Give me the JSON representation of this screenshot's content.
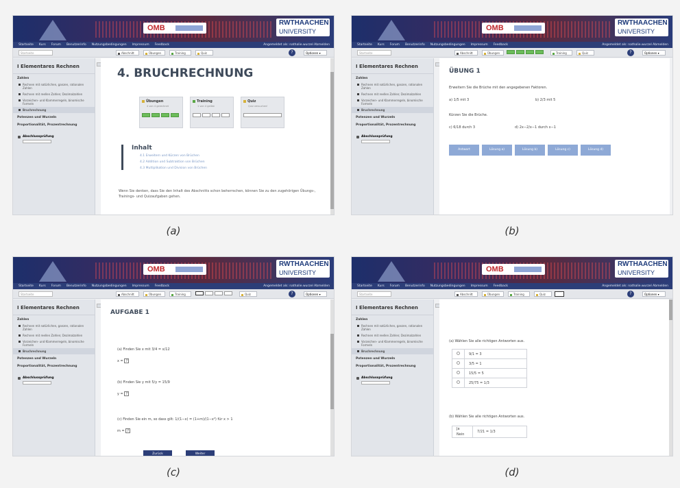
{
  "panels": [
    {
      "caption": "(a)",
      "toolbar": {
        "search": "Startseite",
        "btn1": "Abschnitt",
        "btn2": "Übungen",
        "btn3": "Training",
        "btn4": "Quiz",
        "help": "?",
        "options": "Optionen ▾"
      }
    },
    {
      "caption": "(b)",
      "toolbar": {
        "search": "Startseite",
        "btn1": "Abschnitt",
        "btn2": "Übungen",
        "btn3": "Training",
        "btn4": "Quiz",
        "help": "?",
        "options": "Optionen ▾"
      }
    },
    {
      "caption": "(c)",
      "toolbar": {
        "search": "Startseite",
        "btn1": "Abschnitt",
        "btn2": "Übungen",
        "btn3": "Training",
        "btn4": "Quiz",
        "help": "?",
        "options": "Optionen ▾"
      }
    },
    {
      "caption": "(d)",
      "toolbar": {
        "search": "Startseite",
        "btn1": "Abschnitt",
        "btn2": "Übungen",
        "btn3": "Training",
        "btn4": "Quiz",
        "help": "?",
        "options": "Optionen ▾"
      }
    }
  ],
  "header": {
    "omb": "OMB",
    "rwth_top": "RWTHAACHEN",
    "rwth_bottom": "UNIVERSITY",
    "nav": [
      "Startseite",
      "Kurs",
      "Forum",
      "Benutzerinfo",
      "Nutzungsbedingungen",
      "Impressum",
      "Feedback"
    ],
    "nav_right": "Angemeldet als: nathalie.wurzel   Abmelden"
  },
  "sidebar": {
    "title": "I Elementares Rechnen",
    "section_zahlen": "Zahlen",
    "items": [
      "Rechnen mit natürlichen, ganzen, rationalen Zahlen",
      "Rechnen mit reellen Zahlen; Dezimalzahlen",
      "Vorzeichen- und Klammerregeln, binomische Formeln",
      "Bruchrechnung"
    ],
    "section_potenzen": "Potenzen und Wurzeln",
    "section_proportional": "Proportionalität, Prozentrechnung",
    "abschluss": "Abschlussprüfung"
  },
  "a": {
    "title": "4. BRUCHRECHNUNG",
    "card_uebungen": "Übungen",
    "card_uebungen_sub": "4 von 4 gerechnet",
    "card_training": "Training",
    "card_training_sub": "1 von 4 gelöst",
    "card_quiz": "Quiz",
    "card_quiz_sub": "Quiz versuchen!",
    "inhalt": "Inhalt",
    "toc": [
      "4.1 Erweitern und Kürzen von Brüchen",
      "4.2 Addition und Subtraktion von Brüchen",
      "4.3 Multiplikation und Division von Brüchen"
    ],
    "body": "Wenn Sie denken, dass Sie den Inhalt des Abschnitts schon beherrschen, können Sie zu den zugehörigen Übungs-, Trainings- und Quizaufgaben gehen."
  },
  "b": {
    "title": "ÜBUNG 1",
    "intro1": "Erweitern Sie die Brüche mit den angegebenen Faktoren.",
    "ex1a": "a) 1/5  mit 3",
    "ex1b": "b) 2/3  mit 5",
    "intro2": "Kürzen Sie die Brüche.",
    "ex2a": "c) 6/18  durch 3",
    "ex2b": "d) 2x−2/x−1  durch x−1",
    "buttons": [
      "Antwort",
      "Lösung a)",
      "Lösung b)",
      "Lösung c)",
      "Lösung d)"
    ]
  },
  "c": {
    "title": "AUFGABE 1",
    "q1": "(a) Finden Sie x mit 3/4 = x/12",
    "q2": "(b) Finden Sie y mit 5/y = 15/9",
    "q3": "(c) Finden Sie ein m, so dass gilt: 1/(1−x) = (1+m)/(1−x²) für x > 1",
    "ans_x": "x =",
    "ans_y": "y =",
    "ans_m": "m =",
    "box": "?",
    "btn_prev": "Zurück",
    "btn_next": "Weiter"
  },
  "d": {
    "qa": "(a) Wählen Sie alle richtigen Antworten aus.",
    "qa_opts": [
      "9/1 = 3",
      "3/5 = 1",
      "15/5 = 5",
      "25/75 = 1/3"
    ],
    "qb": "(b) Wählen Sie alle richtigen Antworten aus.",
    "qb_opts": [
      "Ja",
      "Nein"
    ],
    "qb_expr": "7/21 = 1/3"
  }
}
